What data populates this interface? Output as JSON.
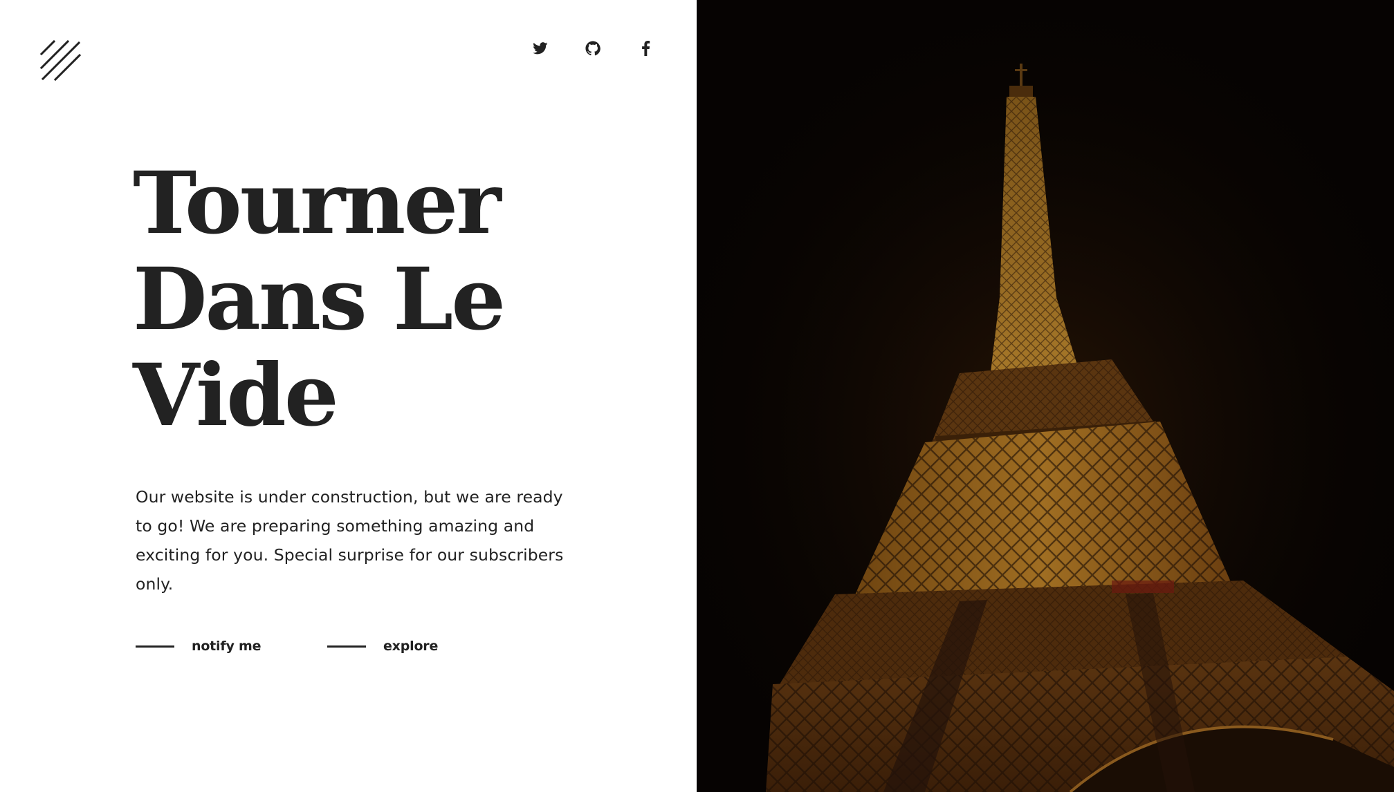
{
  "logo": {
    "icon": "diagonal-lines-logo-icon"
  },
  "social": [
    {
      "name": "twitter",
      "icon": "twitter-icon"
    },
    {
      "name": "github",
      "icon": "github-icon"
    },
    {
      "name": "facebook",
      "icon": "facebook-icon"
    }
  ],
  "hero": {
    "title_lines": [
      "Tourner",
      "Dans Le",
      "Vide"
    ],
    "description": "Our website is under construction, but we are ready to go! We are preparing something amazing and exciting for you. Special surprise for our subscribers only."
  },
  "actions": {
    "notify_label": "notify me",
    "explore_label": "explore"
  },
  "image": {
    "subject": "eiffel-tower-night-photo",
    "colors": {
      "sky": "#060302",
      "lights": "#b07a28",
      "structure": "#3a2008"
    }
  },
  "colors": {
    "text": "#222222",
    "background": "#ffffff"
  }
}
